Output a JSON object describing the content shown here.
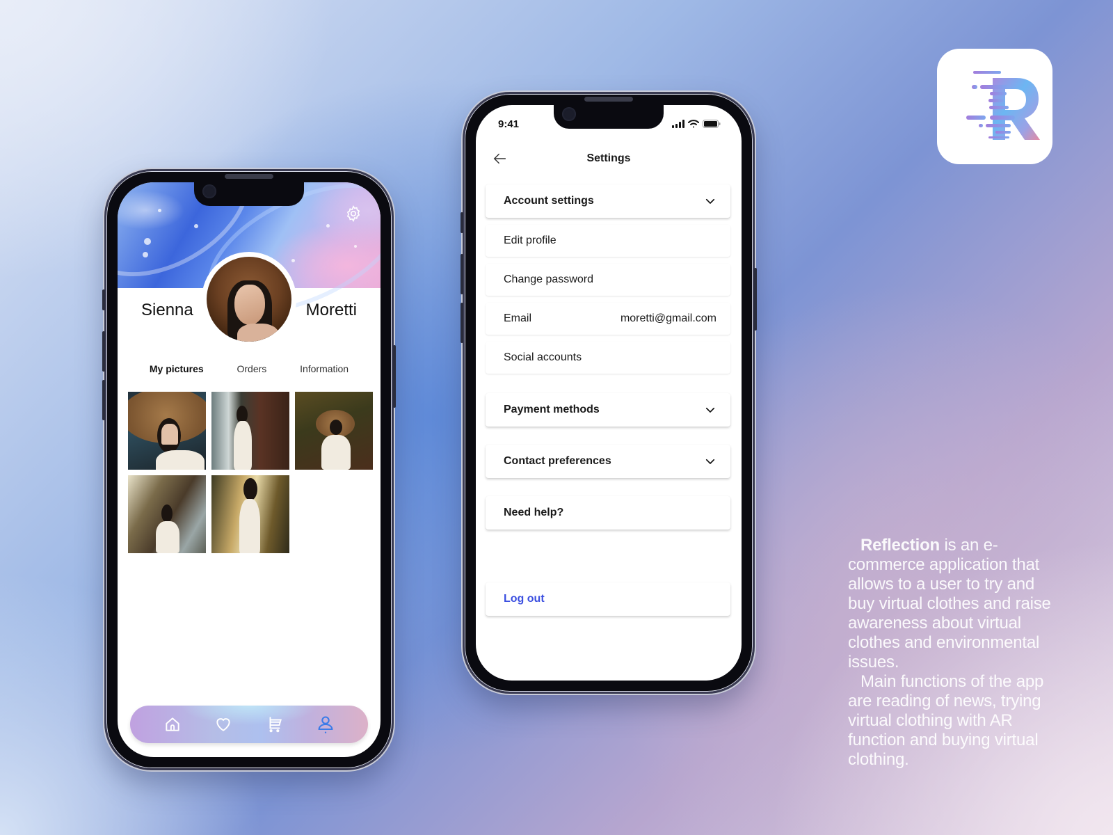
{
  "profile_screen": {
    "first_name": "Sienna",
    "last_name": "Moretti",
    "tabs": [
      {
        "label": "My pictures",
        "active": true
      },
      {
        "label": "Orders",
        "active": false
      },
      {
        "label": "Information",
        "active": false
      }
    ],
    "gallery_count": 5,
    "gear_icon": "gear-icon",
    "bottom_nav": [
      {
        "icon": "home-icon",
        "active": false
      },
      {
        "icon": "heart-icon",
        "active": false
      },
      {
        "icon": "cart-icon",
        "active": false
      },
      {
        "icon": "user-icon",
        "active": true
      }
    ],
    "colors": {
      "active_nav": "#3a7be8"
    }
  },
  "settings_screen": {
    "status_time": "9:41",
    "title": "Settings",
    "sections": {
      "account": "Account settings",
      "edit_profile": "Edit profile",
      "change_password": "Change password",
      "email_label": "Email",
      "email_value": "moretti@gmail.com",
      "social_accounts": "Social accounts",
      "payment": "Payment methods",
      "contact": "Contact preferences",
      "help": "Need help?",
      "logout": "Log out"
    },
    "colors": {
      "logout": "#3b4fe0"
    }
  },
  "brand": {
    "logo_letter": "R",
    "name": "Reflection",
    "desc_p1_rest": " is an e-commerce application that allows to a user to try and buy virtual clothes and raise awareness about virtual clothes and environmental issues.",
    "desc_p2": "Main functions of the app are reading of news, trying virtual clothing with AR function and buying virtual clothing."
  }
}
